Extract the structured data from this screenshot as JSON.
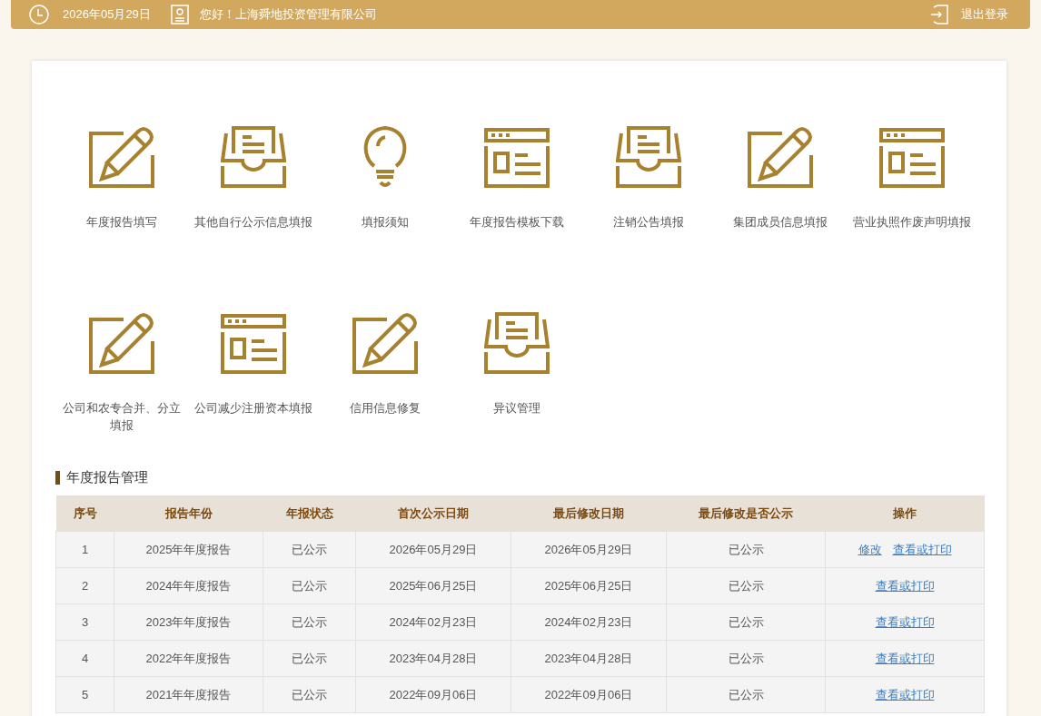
{
  "header": {
    "date": "2026年05月29日",
    "greeting": "您好！上海舜地投资管理有限公司",
    "logout": "退出登录"
  },
  "menu": [
    {
      "label": "年度报告填写",
      "kind": "pencil"
    },
    {
      "label": "其他自行公示信息填报",
      "kind": "inbox"
    },
    {
      "label": "填报须知",
      "kind": "bulb"
    },
    {
      "label": "年度报告模板下载",
      "kind": "window"
    },
    {
      "label": "注销公告填报",
      "kind": "inbox"
    },
    {
      "label": "集团成员信息填报",
      "kind": "pencil"
    },
    {
      "label": "营业执照作废声明填报",
      "kind": "window"
    },
    {
      "label": "公司和农专合并、分立填报",
      "kind": "pencil"
    },
    {
      "label": "公司减少注册资本填报",
      "kind": "window"
    },
    {
      "label": "信用信息修复",
      "kind": "pencil"
    },
    {
      "label": "异议管理",
      "kind": "inbox"
    }
  ],
  "section_title": "年度报告管理",
  "table": {
    "columns": [
      "序号",
      "报告年份",
      "年报状态",
      "首次公示日期",
      "最后修改日期",
      "最后修改是否公示",
      "操作"
    ],
    "rows": [
      {
        "cells": [
          "1",
          "2025年年度报告",
          "已公示",
          "2026年05月29日",
          "2026年05月29日",
          "已公示"
        ],
        "actions": [
          "修改",
          "查看或打印"
        ]
      },
      {
        "cells": [
          "2",
          "2024年年度报告",
          "已公示",
          "2025年06月25日",
          "2025年06月25日",
          "已公示"
        ],
        "actions": [
          "查看或打印"
        ]
      },
      {
        "cells": [
          "3",
          "2023年年度报告",
          "已公示",
          "2024年02月23日",
          "2024年02月23日",
          "已公示"
        ],
        "actions": [
          "查看或打印"
        ]
      },
      {
        "cells": [
          "4",
          "2022年年度报告",
          "已公示",
          "2023年04月28日",
          "2023年04月28日",
          "已公示"
        ],
        "actions": [
          "查看或打印"
        ]
      },
      {
        "cells": [
          "5",
          "2021年年度报告",
          "已公示",
          "2022年09月06日",
          "2022年09月06日",
          "已公示"
        ],
        "actions": [
          "查看或打印"
        ]
      }
    ]
  }
}
